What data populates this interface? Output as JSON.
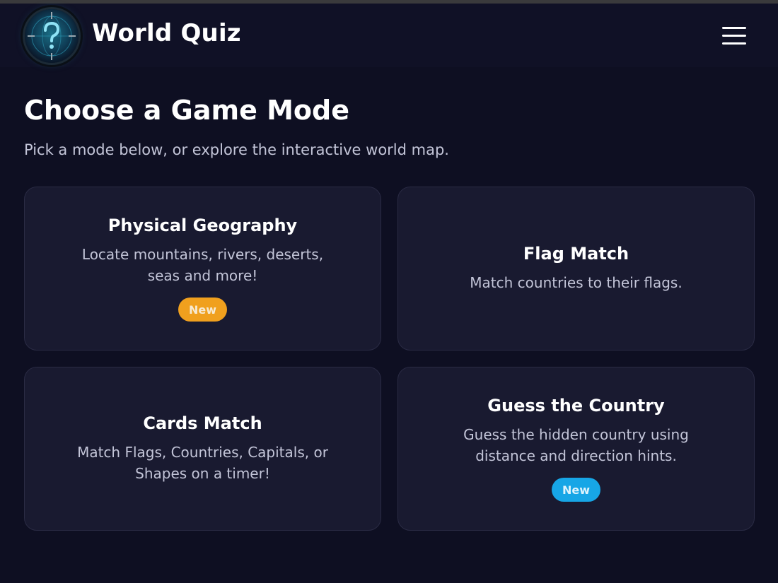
{
  "header": {
    "app_title": "World Quiz",
    "logo_icon": "globe-question-icon",
    "menu_icon": "hamburger-menu-icon"
  },
  "main": {
    "title": "Choose a Game Mode",
    "subtitle": "Pick a mode below, or explore the interactive world map."
  },
  "cards": [
    {
      "title": "Physical Geography",
      "desc_line1": "Locate mountains, rivers, deserts,",
      "desc_line2": "seas and more!",
      "badge": "New",
      "badge_color": "#f0a01e"
    },
    {
      "title": "Flag Match",
      "desc_line1": "Match countries to their flags.",
      "desc_line2": "",
      "badge": "",
      "badge_color": ""
    },
    {
      "title": "Cards Match",
      "desc_line1": "Match Flags, Countries, Capitals, or",
      "desc_line2": "Shapes on a timer!",
      "badge": "",
      "badge_color": ""
    },
    {
      "title": "Guess the Country",
      "desc_line1": "Guess the hidden country using",
      "desc_line2": "distance and direction hints.",
      "badge": "New",
      "badge_color": "#17a6e6"
    }
  ],
  "colors": {
    "background": "#0e0f22",
    "card": "#191a30",
    "text_secondary": "#c3c5d8"
  }
}
